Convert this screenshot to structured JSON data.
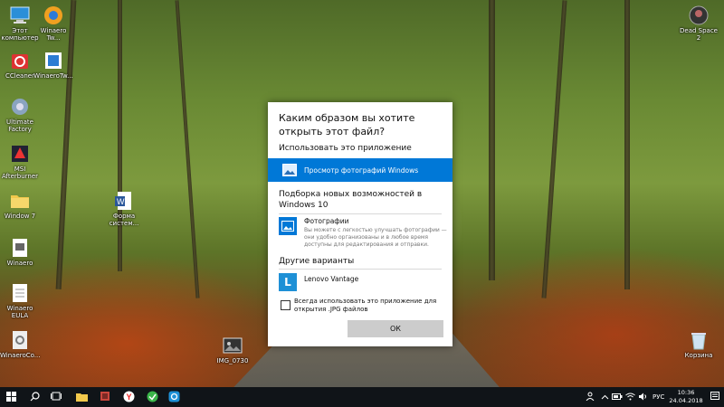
{
  "desktop": {
    "icons_left": [
      {
        "label": "Этот\nкомпьютер",
        "icon": "computer-icon"
      },
      {
        "label": "Winaero Tw...",
        "icon": "winaero-tweaker-icon"
      },
      {
        "label": "CCleaner",
        "icon": "ccleaner-icon"
      },
      {
        "label": "WinaeroTw...",
        "icon": "winaero-tweaker-2-icon"
      },
      {
        "label": "Ultimate\nFactory",
        "icon": "ultimate-factory-icon"
      },
      {
        "label": "MSI\nAfterburner",
        "icon": "msi-afterburner-icon"
      },
      {
        "label": "Window 7",
        "icon": "folder-icon"
      },
      {
        "label": "Форма\nсистем...",
        "icon": "word-document-icon"
      },
      {
        "label": "Winaero",
        "icon": "winaero-icon"
      },
      {
        "label": "Winaero\nEULA",
        "icon": "eula-document-icon"
      },
      {
        "label": "WinaeroCo...",
        "icon": "winaero-config-icon"
      },
      {
        "label": "IMG_0730",
        "icon": "image-file-icon"
      }
    ],
    "icon_dead_space": {
      "label": "Dead Space\n2",
      "icon": "dead-space-icon"
    },
    "icon_recycle_bin": {
      "label": "Корзина",
      "icon": "recycle-bin-icon"
    }
  },
  "dialog": {
    "title": "Каким образом вы хотите открыть этот файл?",
    "section_current": "Использовать это приложение",
    "current_app": {
      "name": "Просмотр фотографий Windows",
      "icon": "photo-viewer-icon"
    },
    "section_new": "Подборка новых возможностей в Windows 10",
    "new_app": {
      "name": "Фотографии",
      "description": "Вы можете с легкостью улучшать фотографии — они удобно организованы и в любое время доступны для редактирования и отправки.",
      "icon": "photos-app-icon"
    },
    "section_other": "Другие варианты",
    "other_app": {
      "name": "Lenovo Vantage",
      "icon_letter": "L"
    },
    "always_use_label": "Всегда использовать это приложение для открытия .JPG файлов",
    "always_use_checked": false,
    "ok_label": "ОК"
  },
  "taskbar": {
    "language": "РУС",
    "time": "10:36",
    "date": "24.04.2018"
  },
  "colors": {
    "accent": "#0078d7",
    "taskbar": "#101418",
    "dialog_bg": "#ffffff",
    "ok_button": "#cccccc"
  }
}
